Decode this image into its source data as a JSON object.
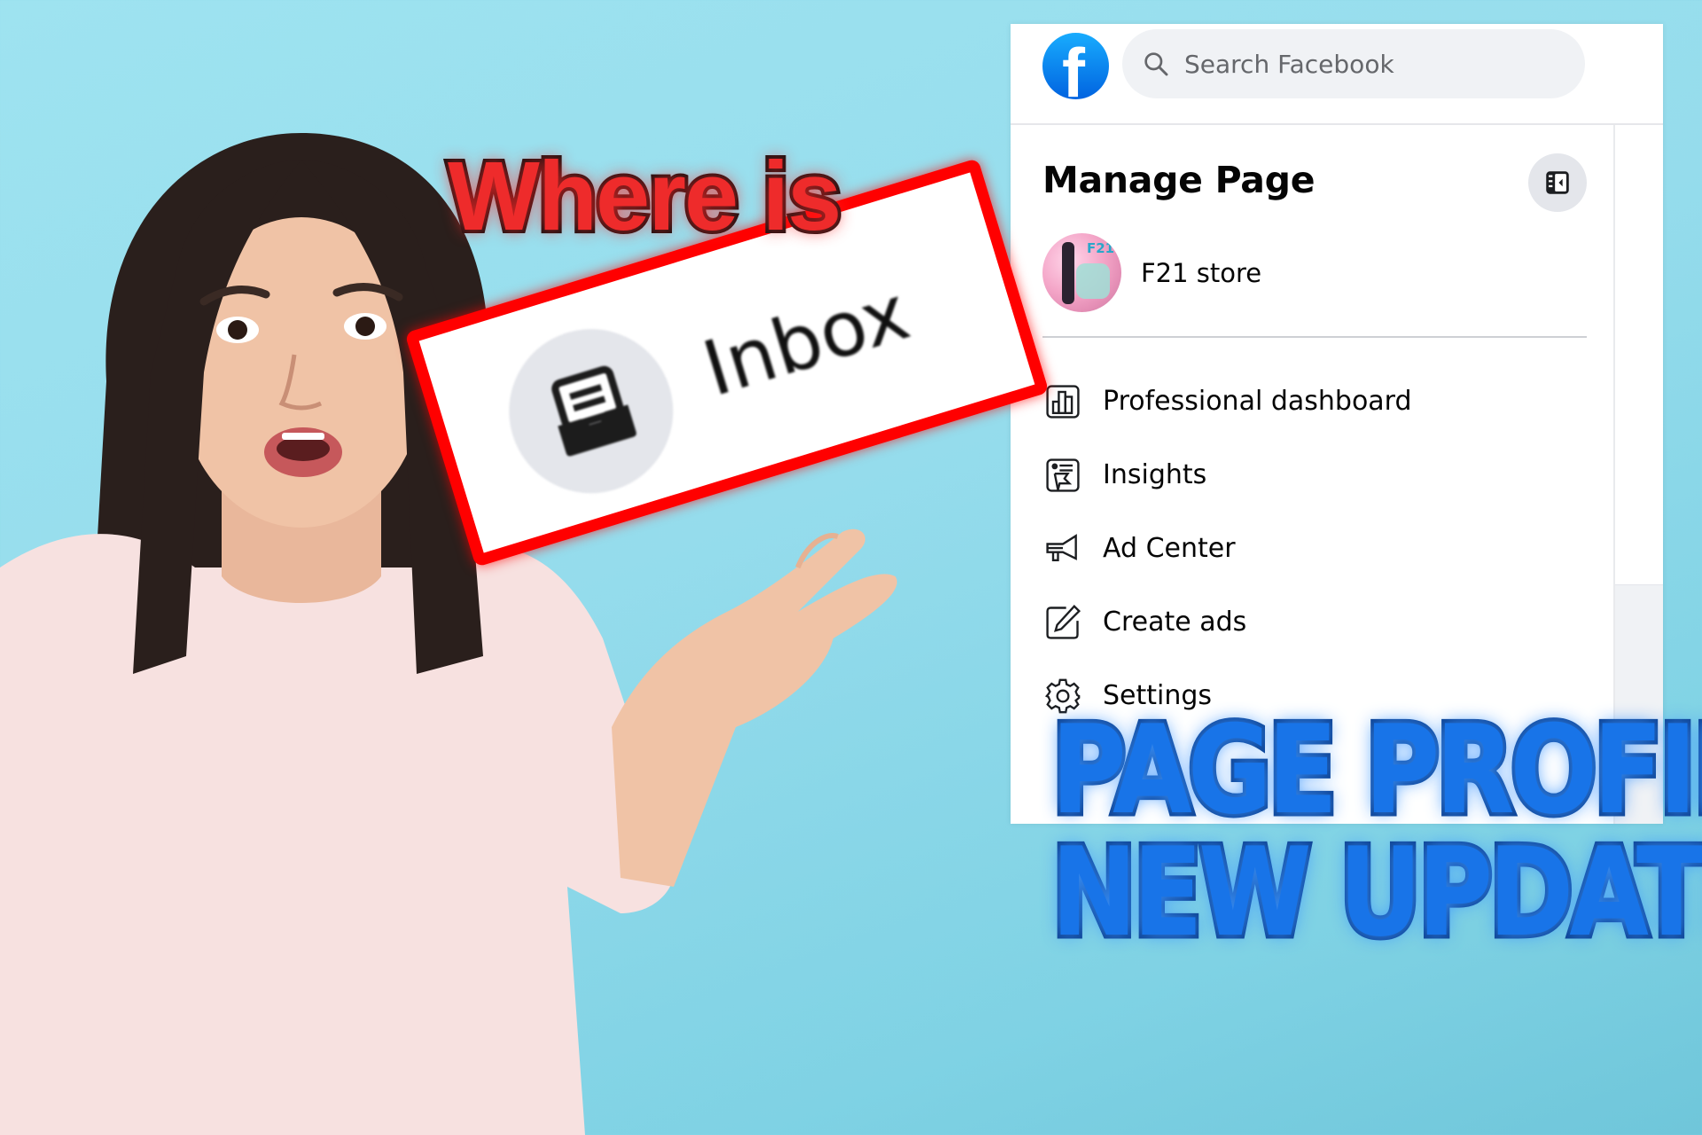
{
  "facebook": {
    "logo_letter": "f",
    "search": {
      "placeholder": "Search Facebook"
    },
    "sidebar": {
      "title": "Manage Page",
      "page_name": "F21 store",
      "menu": [
        {
          "label": "Professional dashboard",
          "icon": "bar-chart-icon"
        },
        {
          "label": "Insights",
          "icon": "insights-icon"
        },
        {
          "label": "Ad Center",
          "icon": "megaphone-icon"
        },
        {
          "label": "Create ads",
          "icon": "edit-icon"
        },
        {
          "label": "Settings",
          "icon": "gear-icon"
        }
      ]
    },
    "colors": {
      "brand": "#0866ff",
      "search_bg": "#f0f2f5"
    }
  },
  "overlay": {
    "question": "Where is",
    "highlighted_item": "Inbox",
    "headline_line1": "PAGE PROFILE",
    "headline_line2": "NEW UPDATE",
    "colors": {
      "question": "#ee2b2b",
      "highlight_border": "#ff0000",
      "headline": "#1874e8"
    }
  }
}
